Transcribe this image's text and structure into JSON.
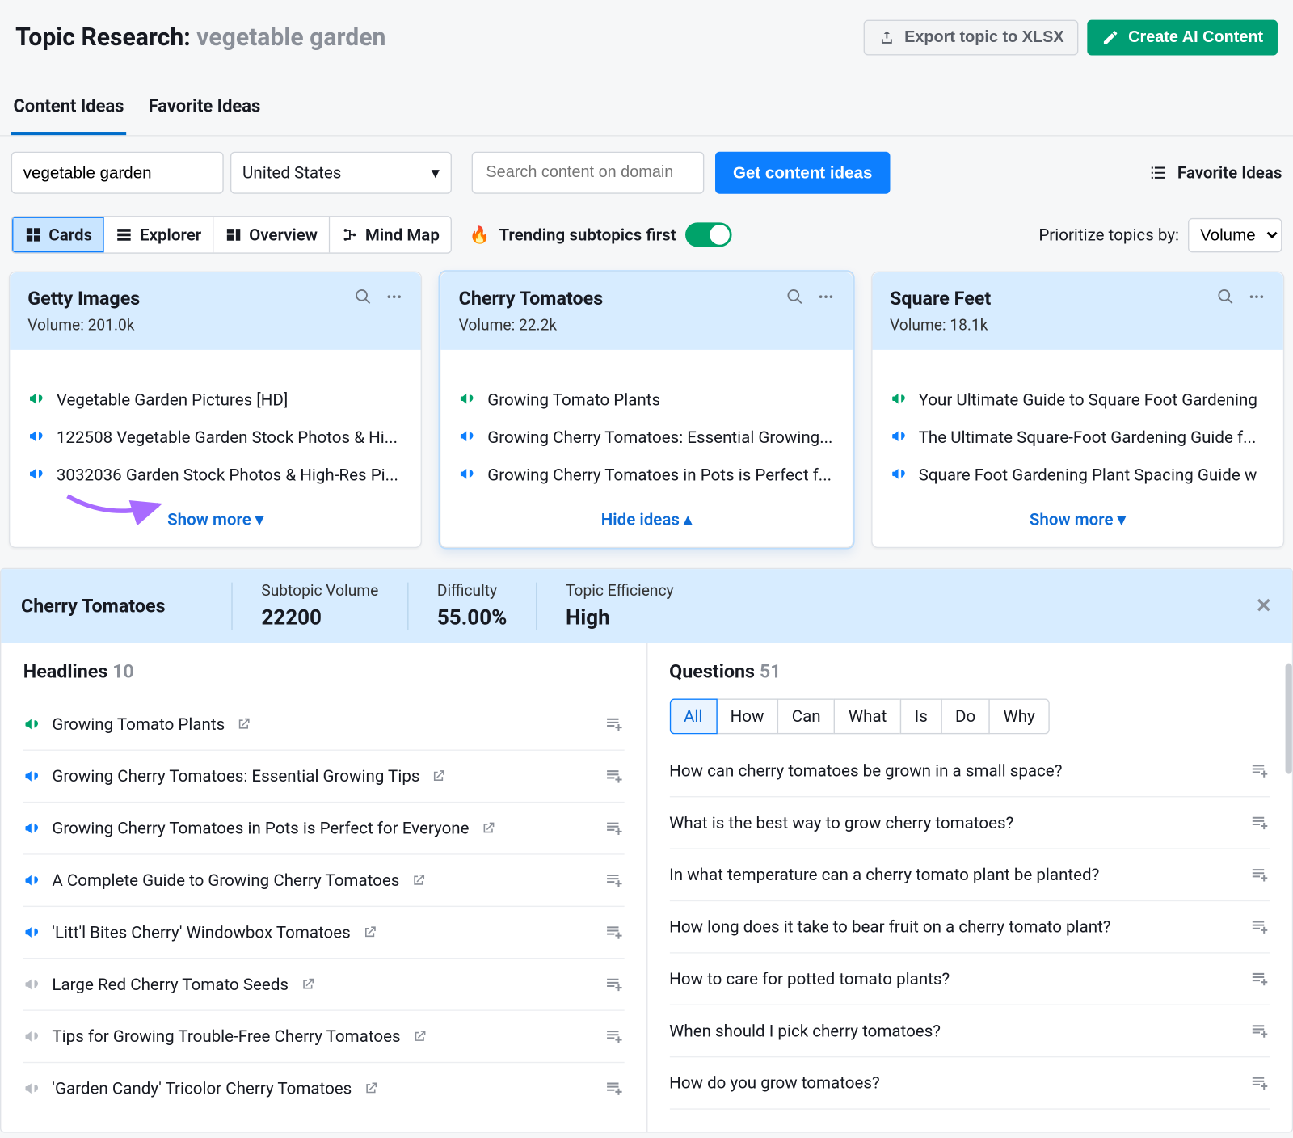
{
  "header": {
    "title_prefix": "Topic Research:",
    "topic": "vegetable garden",
    "export_label": "Export topic to XLSX",
    "create_label": "Create AI Content"
  },
  "tabs": {
    "content": "Content Ideas",
    "favorite": "Favorite Ideas"
  },
  "search": {
    "topic_value": "vegetable garden",
    "country": "United States",
    "domain_placeholder": "Search content on domain",
    "go_label": "Get content ideas",
    "favorite_link": "Favorite Ideas"
  },
  "views": {
    "cards": "Cards",
    "explorer": "Explorer",
    "overview": "Overview",
    "mindmap": "Mind Map",
    "trending": "Trending subtopics first",
    "prio_label": "Prioritize topics by:",
    "prio_value": "Volume"
  },
  "cards": [
    {
      "title": "Getty Images",
      "volume": "Volume: 201.0k",
      "items": [
        {
          "text": "Vegetable Garden Pictures [HD]",
          "color": "#00a36a"
        },
        {
          "text": "122508 Vegetable Garden Stock Photos & Hi...",
          "color": "#0d7fff"
        },
        {
          "text": "3032036 Garden Stock Photos & High-Res Pi...",
          "color": "#0d7fff"
        }
      ],
      "foot": "Show more",
      "chev": "▾"
    },
    {
      "title": "Cherry Tomatoes",
      "volume": "Volume: 22.2k",
      "items": [
        {
          "text": "Growing Tomato Plants",
          "color": "#00a36a"
        },
        {
          "text": "Growing Cherry Tomatoes: Essential Growing...",
          "color": "#0d7fff"
        },
        {
          "text": "Growing Cherry Tomatoes in Pots is Perfect f...",
          "color": "#0d7fff"
        }
      ],
      "foot": "Hide ideas",
      "chev": "▴"
    },
    {
      "title": "Square Feet",
      "volume": "Volume: 18.1k",
      "items": [
        {
          "text": "Your Ultimate Guide to Square Foot Gardening",
          "color": "#00a36a"
        },
        {
          "text": "The Ultimate Square-Foot Gardening Guide f...",
          "color": "#0d7fff"
        },
        {
          "text": "Square Foot Gardening Plant Spacing Guide w",
          "color": "#0d7fff"
        }
      ],
      "foot": "Show more",
      "chev": "▾"
    }
  ],
  "detail": {
    "title": "Cherry Tomatoes",
    "metrics": [
      {
        "label": "Subtopic Volume",
        "value": "22200"
      },
      {
        "label": "Difficulty",
        "value": "55.00%"
      },
      {
        "label": "Topic Efficiency",
        "value": "High"
      }
    ],
    "headlines_label": "Headlines",
    "headlines_count": "10",
    "headlines": [
      {
        "text": "Growing Tomato Plants",
        "color": "#00a36a"
      },
      {
        "text": "Growing Cherry Tomatoes: Essential Growing Tips",
        "color": "#0d7fff"
      },
      {
        "text": "Growing Cherry Tomatoes in Pots is Perfect for Everyone",
        "color": "#0d7fff"
      },
      {
        "text": "A Complete Guide to Growing Cherry Tomatoes",
        "color": "#0d7fff"
      },
      {
        "text": "'Litt'l Bites Cherry' Windowbox Tomatoes",
        "color": "#0d7fff"
      },
      {
        "text": "Large Red Cherry Tomato Seeds",
        "color": "#b8bcc3"
      },
      {
        "text": "Tips for Growing Trouble-Free Cherry Tomatoes",
        "color": "#b8bcc3"
      },
      {
        "text": "'Garden Candy' Tricolor Cherry Tomatoes",
        "color": "#b8bcc3"
      }
    ],
    "questions_label": "Questions",
    "questions_count": "51",
    "qfilters": [
      "All",
      "How",
      "Can",
      "What",
      "Is",
      "Do",
      "Why"
    ],
    "questions": [
      "How can cherry tomatoes be grown in a small space?",
      "What is the best way to grow cherry tomatoes?",
      "In what temperature can a cherry tomato plant be planted?",
      "How long does it take to bear fruit on a cherry tomato plant?",
      "How to care for potted tomato plants?",
      "When should I pick cherry tomatoes?",
      "How do you grow tomatoes?"
    ]
  }
}
